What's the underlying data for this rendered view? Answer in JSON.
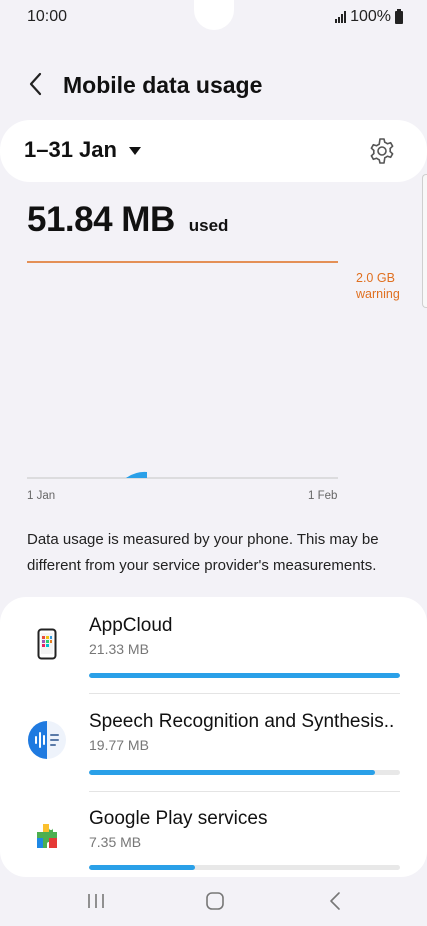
{
  "status_bar": {
    "time": "10:00",
    "battery": "100%"
  },
  "header": {
    "title": "Mobile data usage"
  },
  "period": {
    "label": "1–31 Jan"
  },
  "usage": {
    "amount": "51.84 MB",
    "suffix": "used"
  },
  "chart": {
    "warning_line1": "2.0 GB",
    "warning_line2": "warning",
    "x_start": "1 Jan",
    "x_end": "1 Feb",
    "accent_color": "#e07020",
    "usage_color": "#2aa0e8"
  },
  "info": {
    "text": "Data usage is measured by your phone. This may be different from your service provider's measurements."
  },
  "apps": [
    {
      "name": "AppCloud",
      "size": "21.33 MB",
      "usage_fraction": 1.0,
      "icon": "appcloud-icon"
    },
    {
      "name": "Speech Recognition and Synthesis..",
      "size": "19.77 MB",
      "usage_fraction": 0.92,
      "icon": "speech-icon"
    },
    {
      "name": "Google Play services",
      "size": "7.35 MB",
      "usage_fraction": 0.34,
      "icon": "play-services-icon"
    }
  ],
  "nav": {
    "icons": [
      "recents-icon",
      "home-icon",
      "back-icon"
    ]
  }
}
